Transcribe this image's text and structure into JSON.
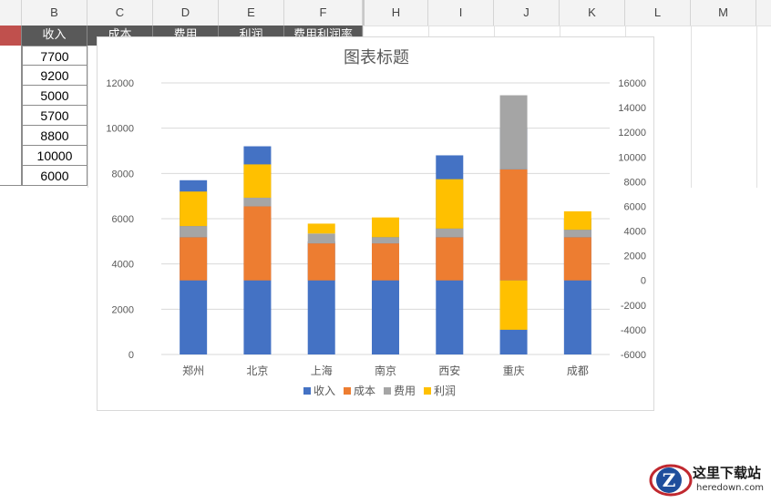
{
  "sheet": {
    "columns": [
      "B",
      "C",
      "D",
      "E",
      "F",
      "H",
      "I",
      "J",
      "K",
      "L",
      "M"
    ],
    "headers": [
      "收入",
      "成本",
      "费用",
      "利润",
      "费用利润率"
    ],
    "income_values": [
      "7700",
      "9200",
      "5000",
      "5700",
      "8800",
      "10000",
      "6000"
    ]
  },
  "chart_data": {
    "type": "bar",
    "title": "图表标题",
    "categories": [
      "郑州",
      "北京",
      "上海",
      "南京",
      "西安",
      "重庆",
      "成都"
    ],
    "series": [
      {
        "name": "收入",
        "color": "#4472C4",
        "values": [
          7700,
          9200,
          5000,
          5700,
          8800,
          10000,
          6000
        ],
        "axis": "left"
      },
      {
        "name": "成本",
        "color": "#ED7D31",
        "values": [
          3500,
          6000,
          3000,
          3000,
          3500,
          9000,
          3500
        ],
        "axis": "right"
      },
      {
        "name": "费用",
        "color": "#A5A5A5",
        "values": [
          900,
          700,
          800,
          500,
          700,
          6000,
          600
        ],
        "axis": "right"
      },
      {
        "name": "利润",
        "color": "#FFC000",
        "values": [
          2800,
          2700,
          800,
          1600,
          4000,
          -4000,
          1500
        ],
        "axis": "right"
      }
    ],
    "ylim_left": [
      0,
      12000
    ],
    "ylim_right": [
      -6000,
      16000
    ],
    "left_ticks": [
      "0",
      "2000",
      "4000",
      "6000",
      "8000",
      "10000",
      "12000"
    ],
    "right_ticks": [
      "-6000",
      "-4000",
      "-2000",
      "0",
      "2000",
      "4000",
      "6000",
      "8000",
      "10000",
      "12000",
      "14000",
      "16000"
    ],
    "legend": [
      "收入",
      "成本",
      "费用",
      "利润"
    ],
    "legend_position": "bottom",
    "grid": true
  },
  "watermark": {
    "text_cn": "这里下载站",
    "text_url": "heredown.com"
  }
}
